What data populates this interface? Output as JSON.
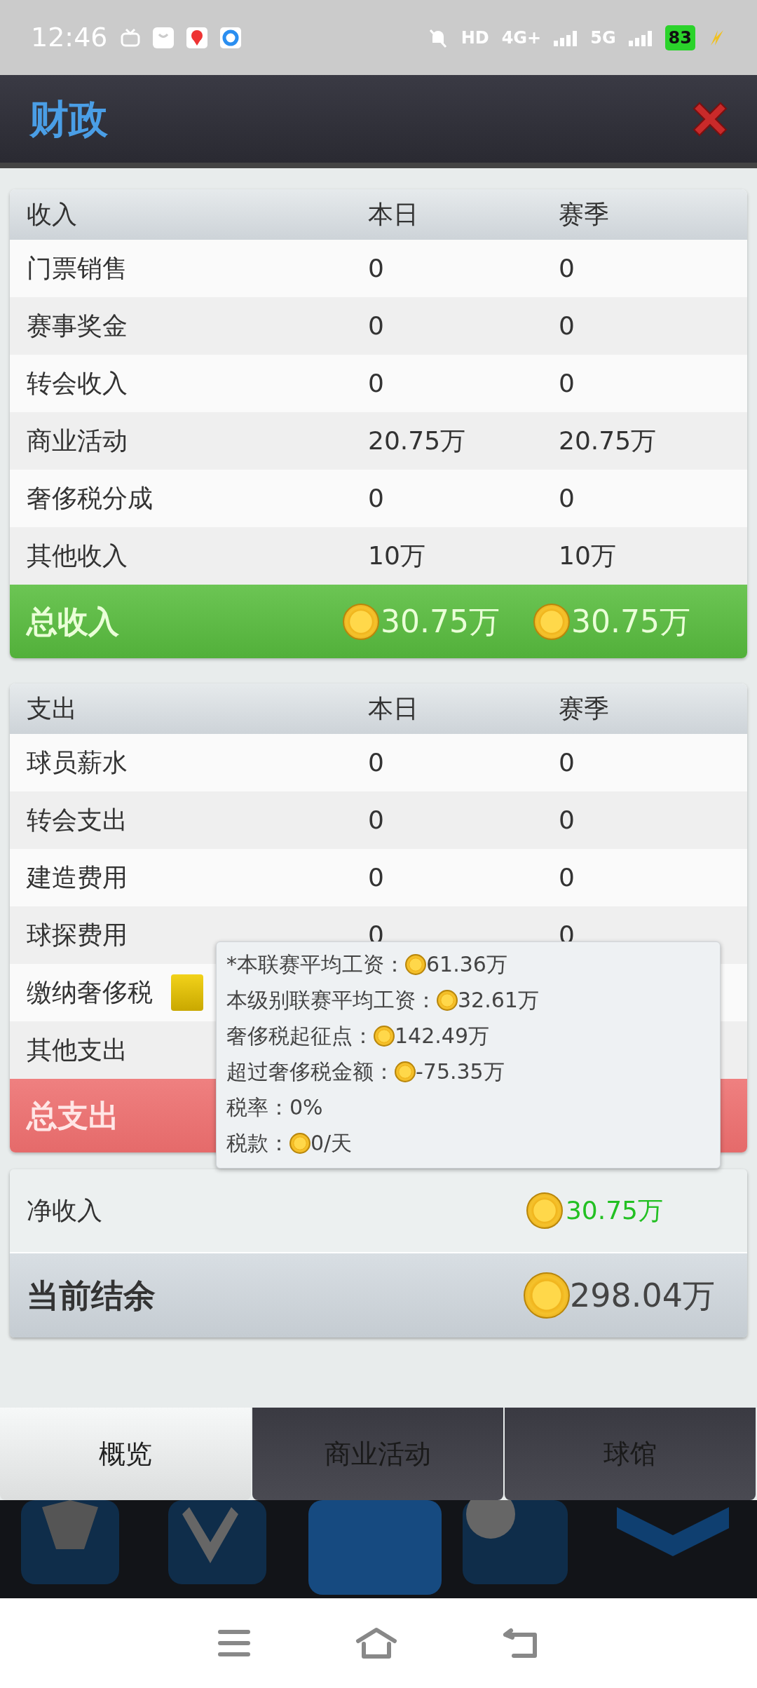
{
  "status_bar": {
    "time": "12:46",
    "hd": "HD",
    "network_1": "4G+",
    "network_2": "5G",
    "battery": "83"
  },
  "header": {
    "title": "财政"
  },
  "income": {
    "columns": [
      "收入",
      "本日",
      "赛季"
    ],
    "rows": [
      {
        "label": "门票销售",
        "day": "0",
        "season": "0"
      },
      {
        "label": "赛事奖金",
        "day": "0",
        "season": "0"
      },
      {
        "label": "转会收入",
        "day": "0",
        "season": "0"
      },
      {
        "label": "商业活动",
        "day": "20.75万",
        "season": "20.75万"
      },
      {
        "label": "奢侈税分成",
        "day": "0",
        "season": "0"
      },
      {
        "label": "其他收入",
        "day": "10万",
        "season": "10万"
      }
    ],
    "total": {
      "label": "总收入",
      "day": "30.75万",
      "season": "30.75万"
    }
  },
  "expense": {
    "columns": [
      "支出",
      "本日",
      "赛季"
    ],
    "rows": [
      {
        "label": "球员薪水",
        "day": "0",
        "season": "0",
        "has_info": false
      },
      {
        "label": "转会支出",
        "day": "0",
        "season": "0",
        "has_info": false
      },
      {
        "label": "建造费用",
        "day": "0",
        "season": "0",
        "has_info": false
      },
      {
        "label": "球探费用",
        "day": "0",
        "season": "0",
        "has_info": false
      },
      {
        "label": "缴纳奢侈税",
        "has_info": true
      },
      {
        "label": "其他支出",
        "has_info": false
      }
    ],
    "total": {
      "label": "总支出"
    }
  },
  "tooltip": [
    {
      "label": "*本联赛平均工资：",
      "coin": true,
      "value": "61.36万"
    },
    {
      "label": "本级别联赛平均工资：",
      "coin": true,
      "value": "32.61万"
    },
    {
      "label": "奢侈税起征点：",
      "coin": true,
      "value": "142.49万"
    },
    {
      "label": "超过奢侈税金额：",
      "coin": true,
      "value": "-75.35万"
    },
    {
      "label": "税率：",
      "coin": false,
      "value": "0%"
    },
    {
      "label": "税款：",
      "coin": true,
      "value": "0/天"
    }
  ],
  "summary": {
    "net_label": "净收入",
    "net_value": "30.75万",
    "balance_label": "当前结余",
    "balance_value": "298.04万"
  },
  "tabs": [
    {
      "label": "概览",
      "selected": true
    },
    {
      "label": "商业活动",
      "selected": false
    },
    {
      "label": "球馆",
      "selected": false
    }
  ]
}
